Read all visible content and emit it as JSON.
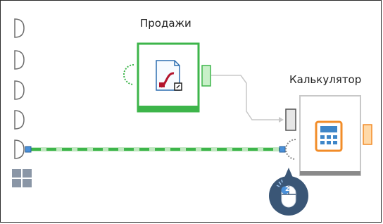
{
  "canvas": {
    "background": "#ffffff",
    "border_color": "#2b2b2b"
  },
  "nodes": {
    "sales": {
      "label": "Продажи",
      "icon": "sales-widget-icon",
      "border_color": "#3db54a",
      "footer_color": "#3db54a",
      "output_port_color": "#c8f0c8"
    },
    "calculator": {
      "label": "Калькулятор",
      "icon": "calculator-icon",
      "border_color": "#c8c8c8",
      "footer_color": "#8a8a8a",
      "output_port_color": "#ffd9a8"
    }
  },
  "links": {
    "sales_to_calculator": {
      "color": "#c8c8c8",
      "style": "solid"
    },
    "input_to_calculator": {
      "color": "#3db54a",
      "style": "dashed"
    }
  },
  "left_palette": {
    "input_ports": 5,
    "grid_icon": "grid-icon"
  },
  "cursor_hint": {
    "icon": "mouse-double-click-icon",
    "badge": "2",
    "background": "#3a5676"
  }
}
